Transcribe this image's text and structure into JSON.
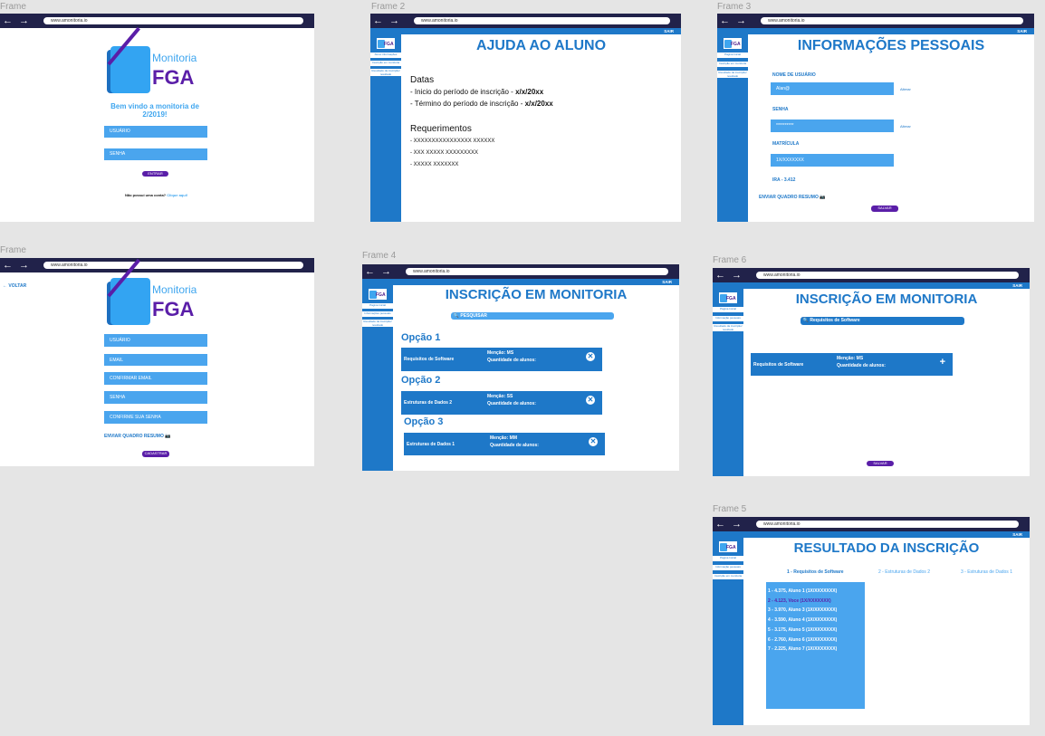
{
  "url": "www.amonitoria.io",
  "nav": {
    "back": "←",
    "forward": "→"
  },
  "sidebar_logo": "FGA",
  "sair": "SAIR",
  "frames": {
    "f1": {
      "label": "Frame",
      "logo_top": "Monitoria",
      "logo_bottom": "FGA",
      "welcome": "Bem vindo a monitoria de 2/2019!",
      "user": "USUÁRIO",
      "password": "SENHA",
      "enter": "ENTRAR",
      "noaccount": "Não possui uma conta?",
      "clickhere": "Clique aqui!"
    },
    "f2": {
      "label": "Frame 2",
      "title": "AJUDA AO ALUNO",
      "side": [
        "Aluno informações",
        "Inscrição em monitoria",
        "Resultado da inscrição/ resultado"
      ],
      "dates_h": "Datas",
      "d1": "- Inicio do período de inscrição - ",
      "d1v": "x/x/20xx",
      "d2": "- Término do período de inscrição - ",
      "d2v": "x/x/20xx",
      "req_h": "Requerimentos",
      "r1": "- XXXXXXXXXXXXXXXX XXXXXX",
      "r2": "- XXX XXXXX XXXXXXXXX",
      "r3": "- XXXXX XXXXXXX"
    },
    "f3": {
      "label": "Frame 3",
      "title": "INFORMAÇÕES PESSOAIS",
      "side": [
        "Página Inicial",
        "Inscrição em monitoria",
        "Resultado da inscrição/ resultado"
      ],
      "user_l": "NOME DE USUÁRIO",
      "user_v": "Alan@",
      "alter": "Alterar",
      "pass_l": "SENHA",
      "pass_v": "**********",
      "mat_l": "MATRÍCULA",
      "mat_v": "1X/XXXXXXX",
      "ira": "IRA - 3.412",
      "quadro": "ENVIAR QUADRO RESUMO 📷",
      "save": "SALVAR"
    },
    "f_cad": {
      "label": "Frame",
      "back": "← VOLTAR",
      "logo_top": "Monitoria",
      "logo_bottom": "FGA",
      "f_user": "USUÁRIO",
      "f_email": "EMAIL",
      "f_cemail": "CONFIRMAR EMAIL",
      "f_pass": "SENHA",
      "f_cpass": "CONFIRME SUA SENHA",
      "quadro": "ENVIAR QUADRO RESUMO 📷",
      "btn": "CADASTRAR"
    },
    "f4": {
      "label": "Frame 4",
      "title": "INSCRIÇÃO EM MONITORIA",
      "side": [
        "Página Inicial",
        "Informações pessoais",
        "Resultado da inscrição/ resultado"
      ],
      "search": "PESQUISAR",
      "o1": "Opção 1",
      "o2": "Opção 2",
      "o3": "Opção 3",
      "cards": [
        {
          "name": "Requisitos de Software",
          "mencao": "Menção: MS",
          "qtd": "Quantidade de alunos:"
        },
        {
          "name": "Estruturas de Dados 2",
          "mencao": "Menção: SS",
          "qtd": "Quantidade de alunos:"
        },
        {
          "name": "Estruturas de Dados 1",
          "mencao": "Menção: MM",
          "qtd": "Quantidade de alunos:"
        }
      ]
    },
    "f6": {
      "label": "Frame 6",
      "title": "INSCRIÇÃO EM MONITORIA",
      "side": [
        "Página Inicial",
        "Informação pessoais",
        "Resultado da inscrição/ resultado"
      ],
      "search": "Requisitos de Software",
      "name": "Requisitos de Software",
      "mencao": "Menção: MS",
      "qtd": "Quantidade de alunos:",
      "plus": "+",
      "save": "SALVAR"
    },
    "f5": {
      "label": "Frame 5",
      "title": "RESULTADO DA INSCRIÇÃO",
      "side": [
        "Página Inicial",
        "Informação pessoais",
        "Inscrição em monitoria"
      ],
      "tabs": [
        "1 - Requisitos de Software",
        "2 - Estruturas de Dados 2",
        "3 - Estruturas de Dados 1"
      ],
      "results": [
        "1 - 4.375, Aluno 1 (1X/XXXXXXX)",
        "2 - 4.123, Voce (1X/XXXXXXX)",
        "3 - 3.970, Aluno 3 (1X/XXXXXXX)",
        "4 - 3.590, Aluno 4 (1X/XXXXXXX)",
        "5 - 3.175, Aluno 5 (1X/XXXXXXX)",
        "6 - 2.760, Aluno 6 (1X/XXXXXXX)",
        "7 - 2.225, Aluno 7 (1X/XXXXXXX)"
      ]
    }
  }
}
